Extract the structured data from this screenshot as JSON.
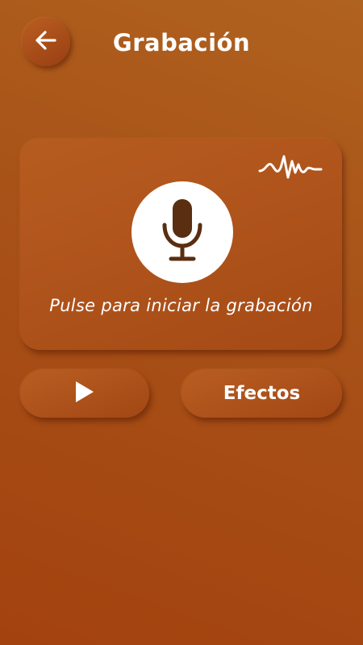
{
  "header": {
    "title": "Grabación",
    "back_icon": "arrow-left-icon"
  },
  "recorder": {
    "hint": "Pulse para iniciar la grabación",
    "mic_icon": "microphone-icon",
    "wave_icon": "sound-wave-icon"
  },
  "controls": {
    "play_icon": "play-icon",
    "effects_label": "Efectos"
  },
  "colors": {
    "background_top": "#b0621f",
    "background_bottom": "#a3420f",
    "mic_glyph": "#5a2e10",
    "mic_circle": "#ffffff"
  }
}
